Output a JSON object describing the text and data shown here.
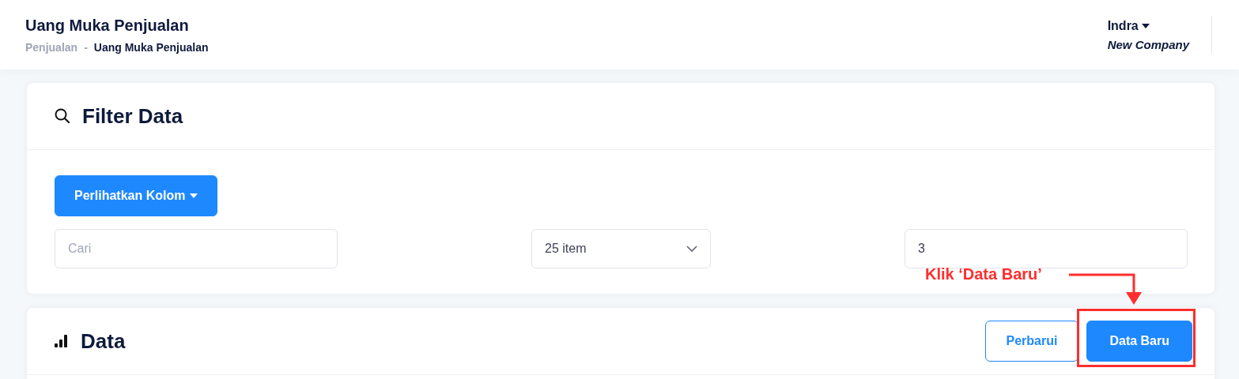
{
  "header": {
    "title": "Uang Muka Penjualan",
    "breadcrumb": [
      {
        "label": "Penjualan",
        "current": false
      },
      {
        "label": "Uang Muka Penjualan",
        "current": true
      }
    ],
    "breadcrumb_separator": "-",
    "user": "Indra",
    "company": "New Company"
  },
  "filter_card": {
    "title": "Filter Data",
    "columns_button": "Perlihatkan Kolom",
    "search": {
      "placeholder": "Cari"
    },
    "page_size": {
      "value": "25 item"
    },
    "page_field": {
      "value": "3"
    }
  },
  "data_card": {
    "title": "Data",
    "buttons": [
      {
        "label": "Perbarui",
        "kind": "outline"
      },
      {
        "label": "Data Baru",
        "kind": "primary"
      }
    ]
  },
  "annotation": {
    "text": "Klik ‘Data Baru’"
  }
}
